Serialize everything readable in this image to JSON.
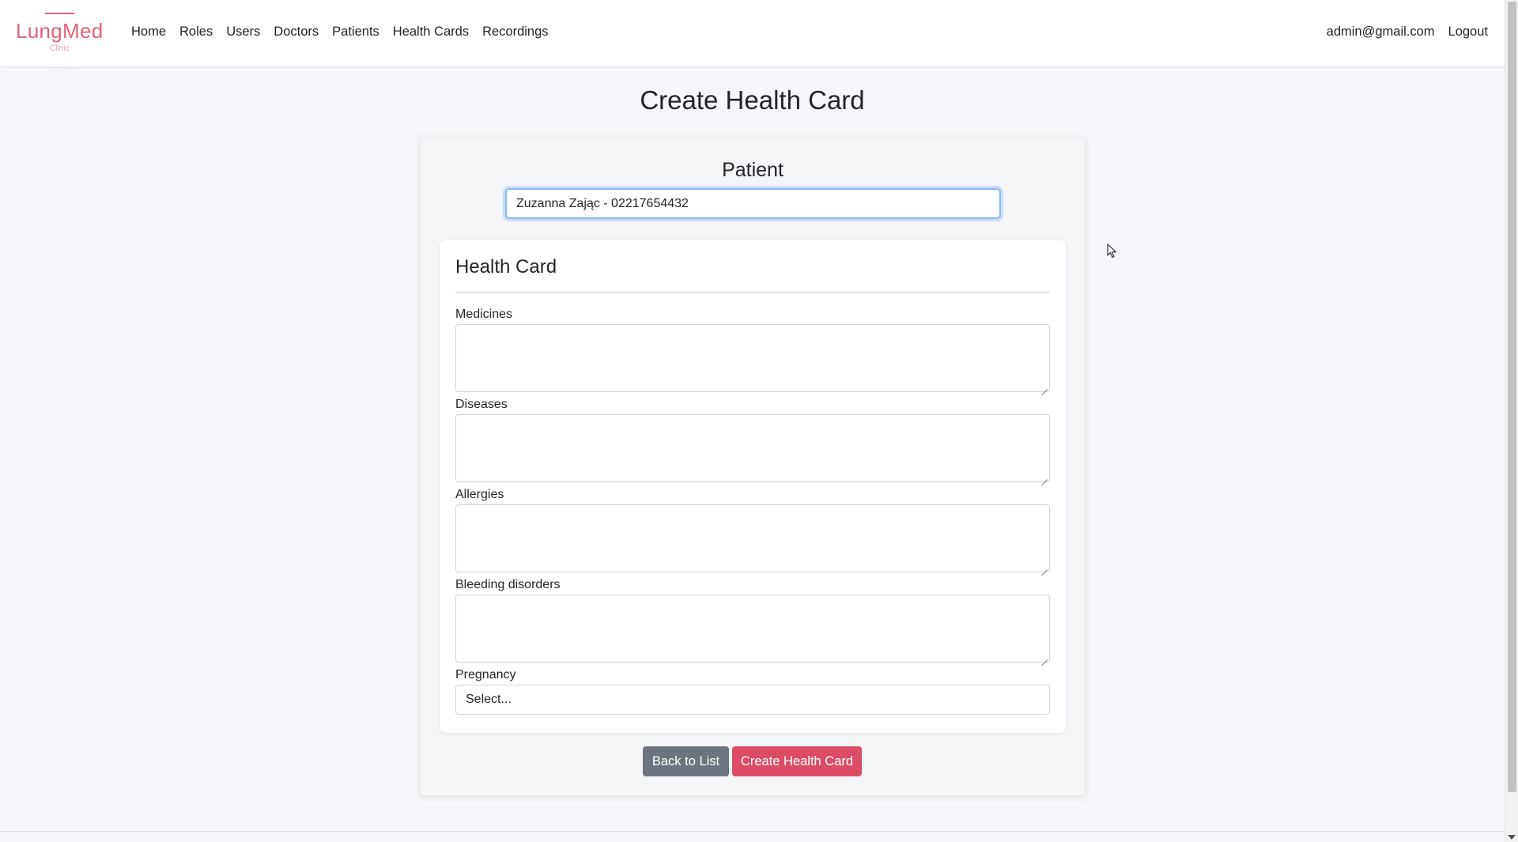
{
  "brand": {
    "name": "LungMed",
    "subtitle": "Clinic"
  },
  "nav": {
    "links": [
      "Home",
      "Roles",
      "Users",
      "Doctors",
      "Patients",
      "Health Cards",
      "Recordings"
    ],
    "user_email": "admin@gmail.com",
    "logout": "Logout"
  },
  "page": {
    "title": "Create Health Card"
  },
  "patient": {
    "label": "Patient",
    "value": "Zuzanna Zając - 02217654432"
  },
  "health_card": {
    "title": "Health Card",
    "fields": [
      {
        "label": "Medicines",
        "value": ""
      },
      {
        "label": "Diseases",
        "value": ""
      },
      {
        "label": "Allergies",
        "value": ""
      },
      {
        "label": "Bleeding disorders",
        "value": ""
      }
    ],
    "pregnancy": {
      "label": "Pregnancy",
      "selected": "Select..."
    }
  },
  "buttons": {
    "back": "Back to List",
    "create": "Create Health Card"
  },
  "colors": {
    "brand": "#e0637a",
    "primary_button": "#dc4c66",
    "secondary_button": "#6c757d",
    "focus_border": "#86b7fe"
  }
}
